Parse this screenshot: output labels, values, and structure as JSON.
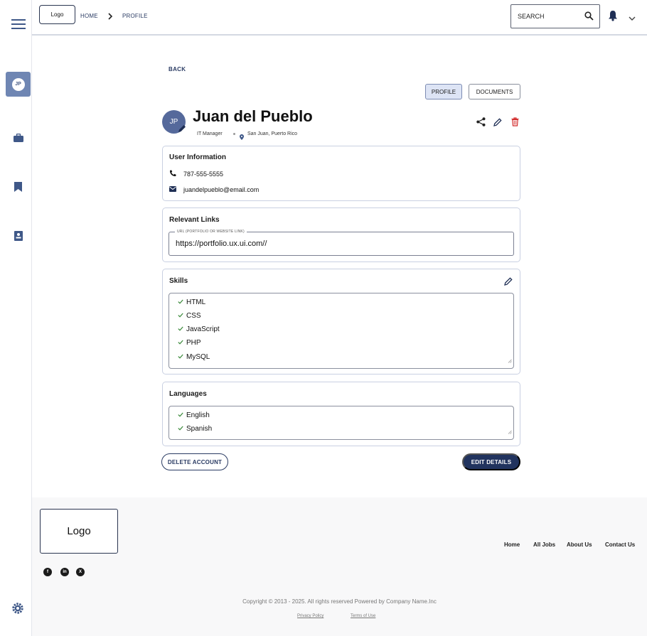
{
  "header": {
    "logo": "Logo",
    "breadcrumb": {
      "home": "HOME",
      "current": "PROFILE"
    },
    "search_label": "SEARCH"
  },
  "sidebar": {
    "avatar_initials": "JP"
  },
  "main": {
    "back": "BACK",
    "tabs": [
      {
        "label": "PROFILE",
        "active": true
      },
      {
        "label": "DOCUMENTS",
        "active": false
      }
    ],
    "profile": {
      "initials": "JP",
      "name": "Juan del Pueblo",
      "title": "IT Manager",
      "location": "San Juan, Puerto Rico"
    },
    "user_information": {
      "heading": "User Information",
      "phone": "787-555-5555",
      "email": "juandelpueblo@email.com"
    },
    "relevant_links": {
      "heading": "Relevant Links",
      "field_label": "URL (PORTFOLIO OR WEBSITE LINK)",
      "field_value": "https://portfolio.ux.ui.com//"
    },
    "skills": {
      "heading": "Skills",
      "items": [
        "HTML",
        "CSS",
        "JavaScript",
        "PHP",
        "MySQL"
      ]
    },
    "languages": {
      "heading": "Languages",
      "items": [
        "English",
        "Spanish"
      ]
    },
    "buttons": {
      "delete": "DELETE ACCOUNT",
      "edit": "EDIT DETAILS"
    }
  },
  "footer": {
    "logo": "Logo",
    "nav": [
      "Home",
      "All Jobs",
      "About Us",
      "Contact Us"
    ],
    "copyright": "Copyright © 2013 - 2025. All rights reserved Powered by Company Name.Inc",
    "privacy": "Privacy Policy",
    "terms": "Terms of Use"
  },
  "colors": {
    "primary": "#21335e",
    "accent": "#55699b",
    "danger": "#d32f2f",
    "check": "#3a8a3a"
  }
}
